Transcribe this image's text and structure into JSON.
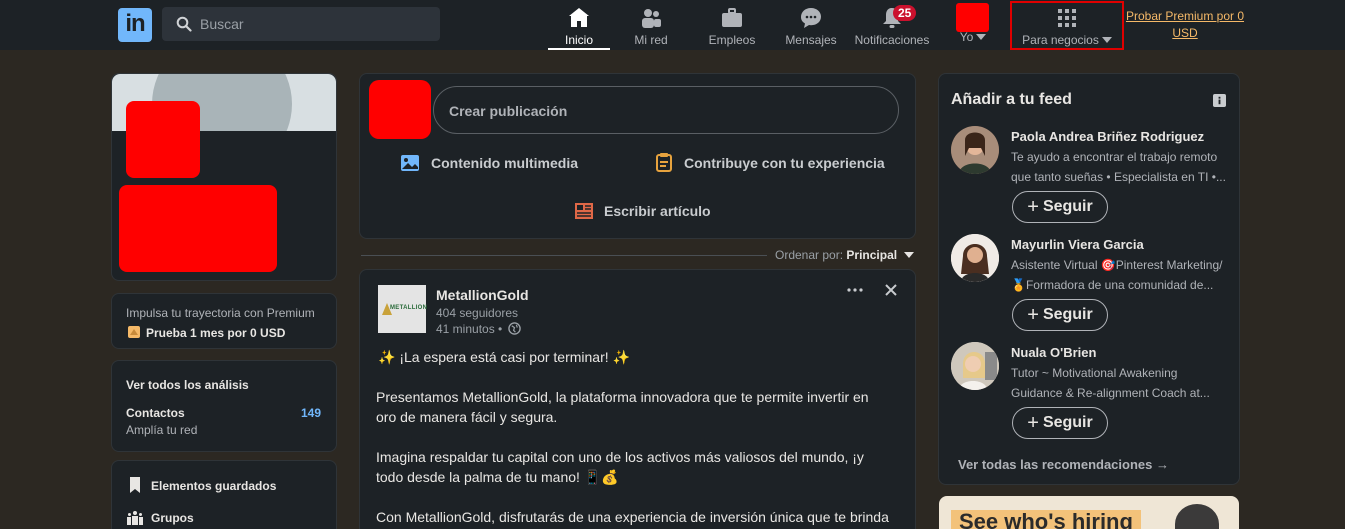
{
  "nav": {
    "logo_text": "in",
    "search_placeholder": "Buscar",
    "items": [
      {
        "label": "Inicio"
      },
      {
        "label": "Mi red"
      },
      {
        "label": "Empleos"
      },
      {
        "label": "Mensajes"
      },
      {
        "label": "Notificaciones",
        "badge": "25"
      },
      {
        "label": "Yo"
      },
      {
        "label": "Para negocios"
      }
    ],
    "premium_line1": "Probar Premium por 0",
    "premium_line2": "USD"
  },
  "left": {
    "premium_prompt": "Impulsa tu trayectoria con Premium",
    "premium_offer": "Prueba 1 mes por 0 USD",
    "analytics_title": "Ver todos los análisis",
    "contacts_label": "Contactos",
    "contacts_count": "149",
    "contacts_sub": "Amplía tu red",
    "saved_items": "Elementos guardados",
    "groups": "Grupos"
  },
  "composer": {
    "placeholder": "Crear publicación",
    "media": "Contenido multimedia",
    "experience": "Contribuye con tu experiencia",
    "article": "Escribir artículo"
  },
  "sort": {
    "label": "Ordenar por:",
    "value": "Principal"
  },
  "post": {
    "author": "MetallionGold",
    "logo_text": "METALLION",
    "followers": "404 seguidores",
    "time": "41 minutos •",
    "lines": [
      "✨ ¡La espera está casi por terminar! ✨",
      "Presentamos MetallionGold, la plataforma innovadora que te permite invertir en",
      "oro de manera fácil y segura.",
      "Imagina respaldar tu capital con uno de los activos más valiosos del mundo, ¡y",
      "todo desde la palma de tu mano! 📱💰",
      "Con MetallionGold, disfrutarás de una experiencia de inversión única que te brinda"
    ]
  },
  "feed": {
    "title": "Añadir a tu feed",
    "follow_label": "Seguir",
    "people": [
      {
        "name": "Paola Andrea Briñez Rodriguez",
        "desc1": "Te ayudo a encontrar el trabajo remoto",
        "desc2": "que tanto sueñas • Especialista en TI •..."
      },
      {
        "name": "Mayurlin Viera Garcia",
        "desc1": "Asistente Virtual 🎯Pinterest Marketing/",
        "desc2": "🏅Formadora de una comunidad de..."
      },
      {
        "name": "Nuala O'Brien",
        "desc1": "Tutor ~ Motivational Awakening",
        "desc2": "Guidance & Re-alignment Coach at..."
      }
    ],
    "see_all": "Ver todas las recomendaciones →"
  },
  "ad": {
    "headline": "See who's hiring"
  },
  "colors": {
    "background": "#2c2822",
    "card": "#1d2226",
    "accent_blue": "#71b7fb",
    "premium_gold": "#f5b968",
    "badge_red": "#cb112d"
  }
}
